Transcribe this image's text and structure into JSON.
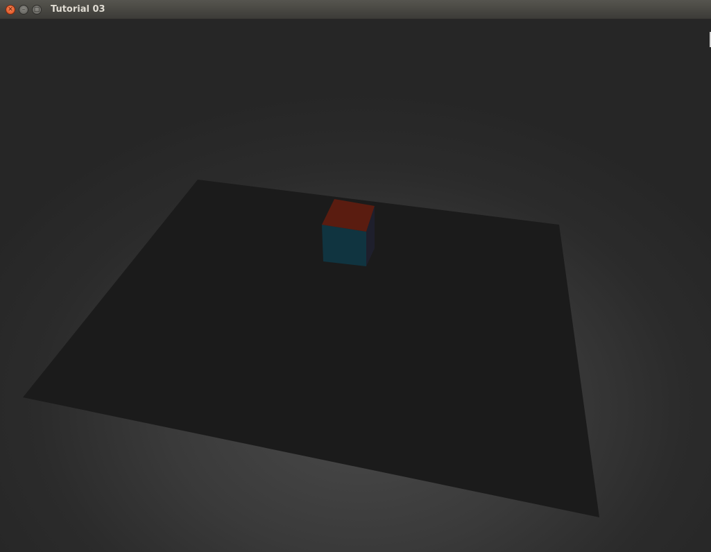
{
  "window": {
    "title": "Tutorial 03",
    "buttons": {
      "close": "close-icon",
      "minimize": "minimize-icon",
      "maximize": "maximize-icon"
    }
  },
  "scene": {
    "colors": {
      "background": "#2b2b2b",
      "floor": "#1b1b1b",
      "cube_top": "#5a1c10",
      "cube_front": "#103440",
      "cube_side": "#1e1f2c"
    }
  }
}
